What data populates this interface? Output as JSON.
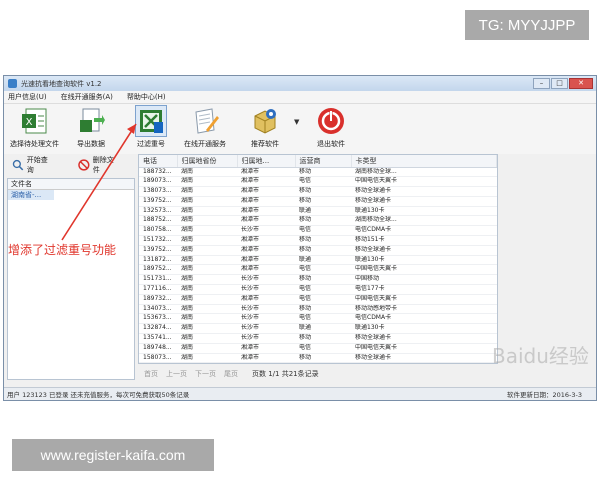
{
  "window": {
    "title": "光速抗看地查询软件 v1.2"
  },
  "menu": [
    "用户信息(U)",
    "在线开通服务(A)",
    "帮助中心(H)"
  ],
  "toolbar": {
    "select_file": "选择待处理文件",
    "export_data": "导出数据",
    "filter_dup": "过滤重号",
    "online_service": "在线开通服务",
    "recommend": "推荐软件",
    "exit": "退出软件"
  },
  "subtoolbar": {
    "start_query": "开始查询",
    "delete_file": "删除文件"
  },
  "leftpane": {
    "header": "文件名",
    "row": "湖南省-..."
  },
  "grid": {
    "columns": [
      "电话",
      "归属地省份",
      "归属地...",
      "运营商",
      "卡类型"
    ],
    "rows": [
      [
        "188732...",
        "湖南",
        "湘潭市",
        "移动",
        "湖南移动全球..."
      ],
      [
        "189073...",
        "湖南",
        "湘潭市",
        "电信",
        "中国电信天翼卡"
      ],
      [
        "138073...",
        "湖南",
        "湘潭市",
        "移动",
        "移动全球通卡"
      ],
      [
        "139752...",
        "湖南",
        "湘潭市",
        "移动",
        "移动全球通卡"
      ],
      [
        "132573...",
        "湖南",
        "湘潭市",
        "联通",
        "联通130卡"
      ],
      [
        "188752...",
        "湖南",
        "湘潭市",
        "移动",
        "湖南移动全球..."
      ],
      [
        "180758...",
        "湖南",
        "长沙市",
        "电信",
        "电信CDMA卡"
      ],
      [
        "151732...",
        "湖南",
        "湘潭市",
        "移动",
        "移动151卡"
      ],
      [
        "139752...",
        "湖南",
        "湘潭市",
        "移动",
        "移动全球通卡"
      ],
      [
        "131872...",
        "湖南",
        "湘潭市",
        "联通",
        "联通130卡"
      ],
      [
        "189752...",
        "湖南",
        "湘潭市",
        "电信",
        "中国电信天翼卡"
      ],
      [
        "151731...",
        "湖南",
        "长沙市",
        "移动",
        "中国移动"
      ],
      [
        "177116...",
        "湖南",
        "长沙市",
        "电信",
        "电信177卡"
      ],
      [
        "189732...",
        "湖南",
        "湘潭市",
        "电信",
        "中国电信天翼卡"
      ],
      [
        "134073...",
        "湖南",
        "长沙市",
        "移动",
        "移动动感地带卡"
      ],
      [
        "153673...",
        "湖南",
        "长沙市",
        "电信",
        "电信CDMA卡"
      ],
      [
        "132874...",
        "湖南",
        "长沙市",
        "联通",
        "联通130卡"
      ],
      [
        "135741...",
        "湖南",
        "长沙市",
        "移动",
        "移动全球通卡"
      ],
      [
        "189748...",
        "湖南",
        "湘潭市",
        "电信",
        "中国电信天翼卡"
      ],
      [
        "158073...",
        "湖南",
        "湘潭市",
        "移动",
        "移动全球通卡"
      ]
    ]
  },
  "pager": {
    "first": "首页",
    "prev": "上一页",
    "next": "下一页",
    "last": "尾页",
    "info": "页数 1/1 共21条记录"
  },
  "status": {
    "left": "用户 123123 已登录 还未充值服务，每次可免费获取50条记录",
    "right": "软件更新日期：2016-3-3"
  },
  "annotation": {
    "text": "增添了过滤重号功能"
  },
  "overlays": {
    "tg": "TG: MYYJJPP",
    "url": "www.register-kaifa.com",
    "watermark": "Baidu经验"
  },
  "colors": {
    "annotation": "#e0362c",
    "accent": "#3a7fc8"
  },
  "icons": {
    "select_file": "excel-icon",
    "export_data": "export-icon",
    "filter_dup": "filter-icon",
    "online_service": "document-pen-icon",
    "recommend": "software-box-icon",
    "exit": "power-icon"
  }
}
